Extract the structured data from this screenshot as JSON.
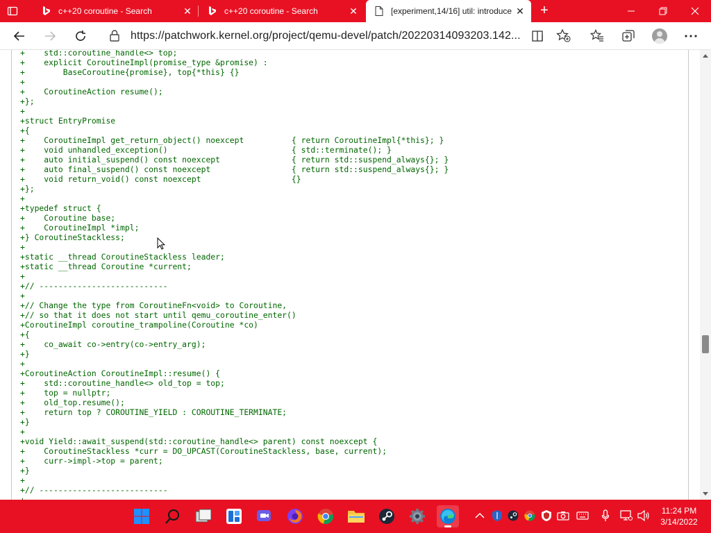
{
  "browser": {
    "tabs": [
      {
        "title": "c++20 coroutine - Search",
        "icon": "bing-icon"
      },
      {
        "title": "c++20 coroutine - Search",
        "icon": "bing-icon"
      },
      {
        "title": "[experiment,14/16] util: introduce",
        "icon": "document-icon",
        "active": true
      }
    ],
    "url_host": "https://patchwork.kernel.org",
    "url_path": "/project/qemu-devel/patch/20220314093203.142..."
  },
  "code_lines": [
    "+    std::coroutine_handle<> top;",
    "+    explicit CoroutineImpl(promise_type &promise) :",
    "+        BaseCoroutine{promise}, top{*this} {}",
    "+",
    "+    CoroutineAction resume();",
    "+};",
    "+",
    "+struct EntryPromise",
    "+{",
    "+    CoroutineImpl get_return_object() noexcept          { return CoroutineImpl{*this}; }",
    "+    void unhandled_exception()                          { std::terminate(); }",
    "+    auto initial_suspend() const noexcept               { return std::suspend_always{}; }",
    "+    auto final_suspend() const noexcept                 { return std::suspend_always{}; }",
    "+    void return_void() const noexcept                   {}",
    "+};",
    "+",
    "+typedef struct {",
    "+    Coroutine base;",
    "+    CoroutineImpl *impl;",
    "+} CoroutineStackless;",
    "+",
    "+static __thread CoroutineStackless leader;",
    "+static __thread Coroutine *current;",
    "+",
    "+// ---------------------------",
    "+",
    "+// Change the type from CoroutineFn<void> to Coroutine,",
    "+// so that it does not start until qemu_coroutine_enter()",
    "+CoroutineImpl coroutine_trampoline(Coroutine *co)",
    "+{",
    "+    co_await co->entry(co->entry_arg);",
    "+}",
    "+",
    "+CoroutineAction CoroutineImpl::resume() {",
    "+    std::coroutine_handle<> old_top = top;",
    "+    top = nullptr;",
    "+    old_top.resume();",
    "+    return top ? COROUTINE_YIELD : COROUTINE_TERMINATE;",
    "+}",
    "+",
    "+void Yield::await_suspend(std::coroutine_handle<> parent) const noexcept {",
    "+    CoroutineStackless *curr = DO_UPCAST(CoroutineStackless, base, current);",
    "+    curr->impl->top = parent;",
    "+}",
    "+",
    "+// ---------------------------",
    "+"
  ],
  "taskbar": {
    "apps": [
      "start-icon",
      "search-icon",
      "task-view-icon",
      "widgets-icon",
      "chat-icon",
      "firefox-icon",
      "chrome-icon",
      "file-explorer-icon",
      "steam-icon",
      "settings-icon",
      "edge-icon"
    ],
    "time": "11:24 PM",
    "date": "3/14/2022"
  },
  "colors": {
    "accent": "#e81123",
    "code_green": "#006600"
  }
}
